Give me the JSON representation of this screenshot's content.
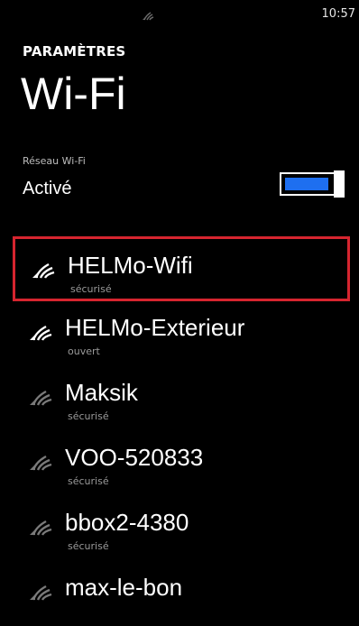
{
  "status_bar": {
    "time": "10:57",
    "signal_icon": "cell-signal-icon"
  },
  "header": {
    "app_title": "PARAMÈTRES",
    "page_title": "Wi-Fi"
  },
  "wifi_toggle": {
    "label": "Réseau Wi-Fi",
    "state": "Activé",
    "on": true,
    "accent_color": "#1e6ff0"
  },
  "highlight_color": "#d6252f",
  "networks": [
    {
      "name": "HELMo-Wifi",
      "status": "sécurisé",
      "selected": true
    },
    {
      "name": "HELMo-Exterieur",
      "status": "ouvert"
    },
    {
      "name": "Maksik",
      "status": "sécurisé"
    },
    {
      "name": "VOO-520833",
      "status": "sécurisé"
    },
    {
      "name": "bbox2-4380",
      "status": "sécurisé"
    },
    {
      "name": "max-le-bon",
      "status": ""
    }
  ]
}
